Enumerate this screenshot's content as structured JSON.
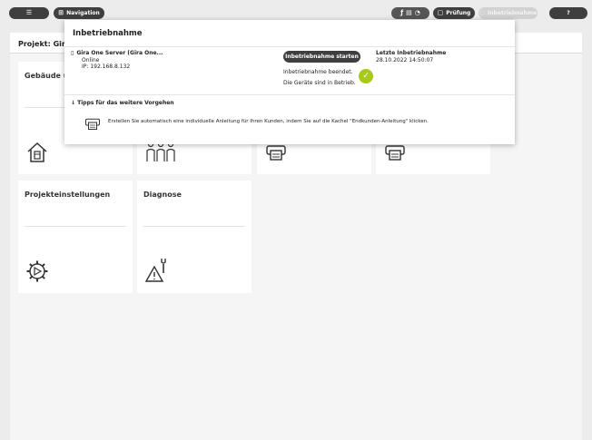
{
  "toolbar": {
    "menu_icon": "list-icon",
    "navigation_label": "Navigation",
    "navigation_icon": "grid-icon",
    "pruefung_label": "Prüfung",
    "inbetriebnahme_label": "Inbetriebnahme",
    "help_label": "?"
  },
  "project": {
    "title": "Projekt: Gira"
  },
  "tiles": [
    {
      "title": "Gebäude u",
      "icon": "house-icon"
    },
    {
      "title": "",
      "icon": "people-icon"
    },
    {
      "title": "",
      "icon": "printer-icon"
    },
    {
      "title": "",
      "icon": "printer-icon"
    },
    {
      "title": "Projekteinstellungen",
      "icon": "gear-icon"
    },
    {
      "title": "Diagnose",
      "icon": "warning-wrench-icon"
    }
  ],
  "popup": {
    "title": "Inbetriebnahme",
    "server": {
      "name": "Gira One Server (Gira One...",
      "status": "Online",
      "ip": "IP: 192.168.8.132"
    },
    "start_button": "Inbetriebnahme starten",
    "status_line1": "Inbetriebnahme beendet.",
    "status_line2": "Die Geräte sind in Betrieb.",
    "last_label": "Letzte Inbetriebnahme",
    "last_value": "28.10.2022 14:50:07",
    "tips_header": "Tipps für das weitere Vorgehen",
    "tip_text": "Erstellen Sie automatisch eine individuelle Anleitung für Ihren Kunden, indem Sie auf die Kachel \"Endkunden-Anleitung\" klicken."
  },
  "colors": {
    "dark_pill": "#3f3f3f",
    "success": "#a6c91a",
    "background": "#ececec"
  }
}
